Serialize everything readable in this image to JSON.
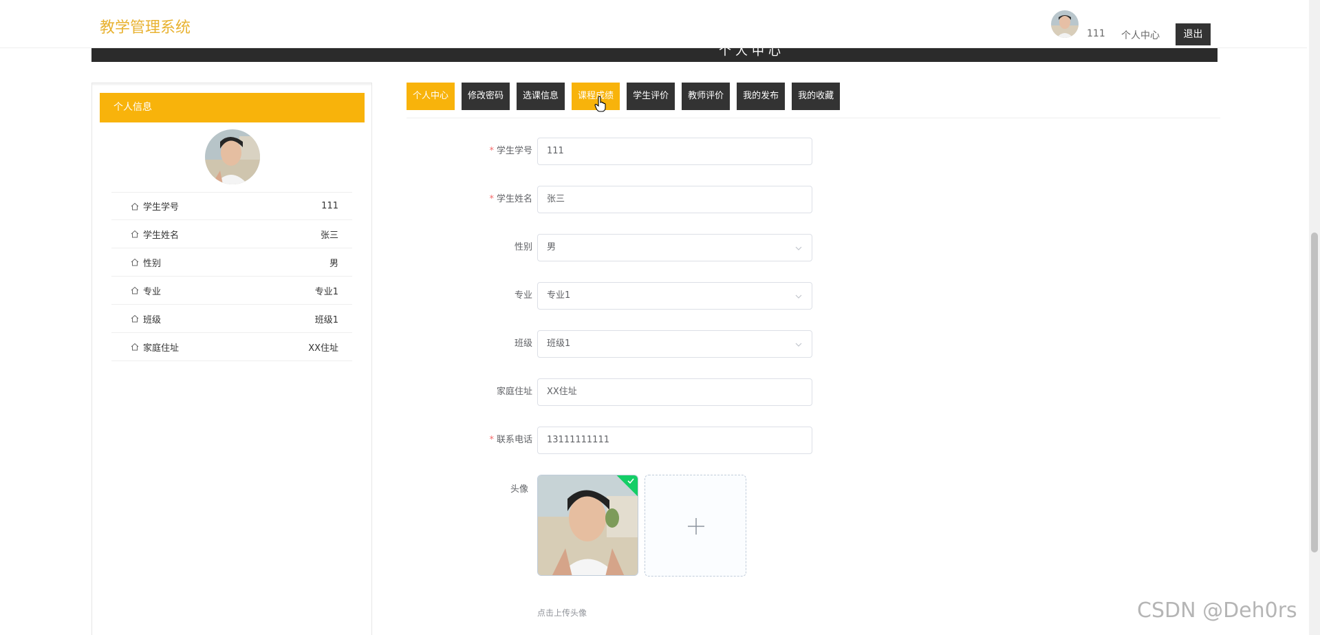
{
  "header": {
    "logo": "教学管理系统",
    "username": "111",
    "personal_center": "个人中心",
    "logout": "退出"
  },
  "banner": {
    "title": "个人中心"
  },
  "sidebar": {
    "title": "个人信息",
    "items": [
      {
        "label": "学生学号",
        "value": "111"
      },
      {
        "label": "学生姓名",
        "value": "张三"
      },
      {
        "label": "性别",
        "value": "男"
      },
      {
        "label": "专业",
        "value": "专业1"
      },
      {
        "label": "班级",
        "value": "班级1"
      },
      {
        "label": "家庭住址",
        "value": "XX住址"
      }
    ]
  },
  "tabs": [
    {
      "label": "个人中心",
      "state": "active"
    },
    {
      "label": "修改密码",
      "state": ""
    },
    {
      "label": "选课信息",
      "state": ""
    },
    {
      "label": "课程成绩",
      "state": "hover"
    },
    {
      "label": "学生评价",
      "state": ""
    },
    {
      "label": "教师评价",
      "state": ""
    },
    {
      "label": "我的发布",
      "state": ""
    },
    {
      "label": "我的收藏",
      "state": ""
    }
  ],
  "form": {
    "student_id": {
      "label": "学生学号",
      "value": "111",
      "required": true
    },
    "student_name": {
      "label": "学生姓名",
      "value": "张三",
      "required": true
    },
    "gender": {
      "label": "性别",
      "value": "男",
      "required": false
    },
    "major": {
      "label": "专业",
      "value": "专业1",
      "required": false
    },
    "class": {
      "label": "班级",
      "value": "班级1",
      "required": false
    },
    "address": {
      "label": "家庭住址",
      "value": "XX住址",
      "required": false
    },
    "phone": {
      "label": "联系电话",
      "value": "13111111111",
      "required": true
    },
    "avatar": {
      "label": "头像",
      "hint": "点击上传头像"
    }
  },
  "watermark": "CSDN @Deh0rs",
  "colors": {
    "accent": "#F8B30B",
    "logo": "#E8B231",
    "dark": "#333333",
    "required": "#F56C6C",
    "success": "#13ce66"
  }
}
